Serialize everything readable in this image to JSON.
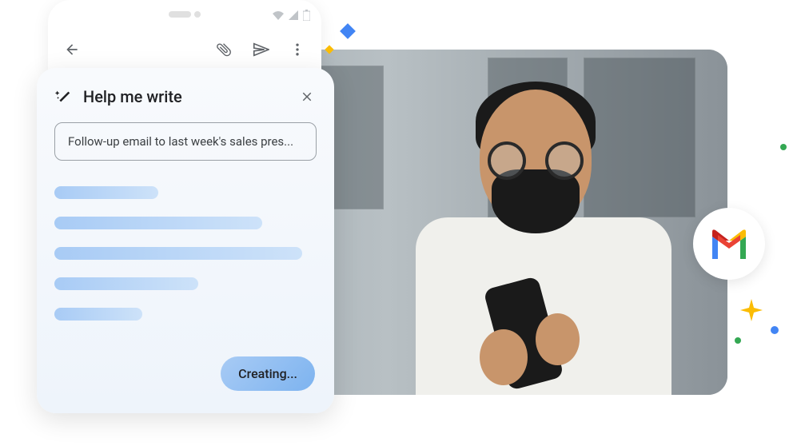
{
  "modal": {
    "title": "Help me write",
    "prompt_value": "Follow-up email to last week's sales pres...",
    "creating_label": "Creating..."
  },
  "skeleton": {
    "widths": [
      130,
      260,
      310,
      180,
      110
    ]
  },
  "icons": {
    "magic_wand": "magic-wand-icon",
    "close": "close-icon",
    "back": "back-arrow-icon",
    "attachment": "attachment-icon",
    "send": "send-icon",
    "more": "more-vert-icon",
    "gmail": "gmail-logo"
  }
}
